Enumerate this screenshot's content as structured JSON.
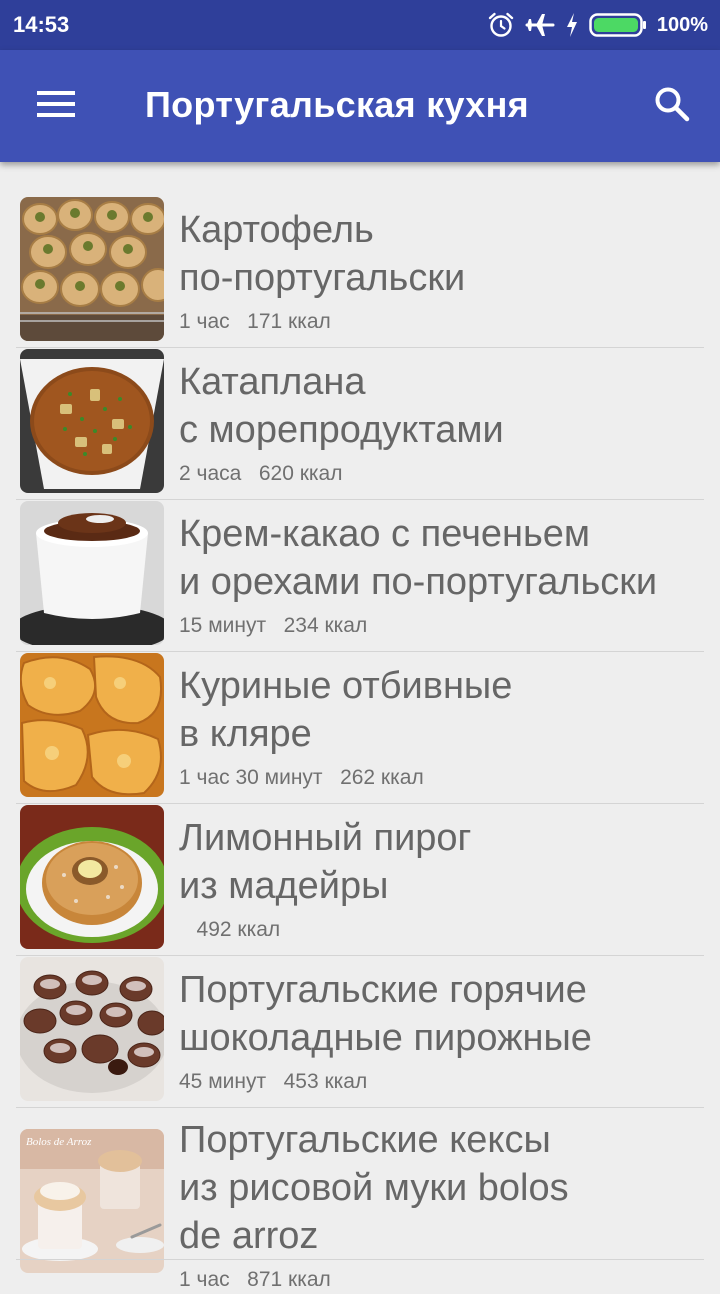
{
  "status_bar": {
    "time": "14:53",
    "battery": "100%",
    "icons": [
      "alarm-icon",
      "airplane-mode-icon",
      "charging-icon",
      "battery-icon"
    ]
  },
  "app_bar": {
    "title": "Португальская кухня",
    "menu_icon": "hamburger-menu-icon",
    "search_icon": "search-icon"
  },
  "recipes": [
    {
      "title": "Картофель\nпо-португальски",
      "time": "1 час",
      "kcal": "171 ккал",
      "image": "baked-potatoes"
    },
    {
      "title": "Катаплана\nс морепродуктами",
      "time": "2 часа",
      "kcal": "620 ккал",
      "image": "seafood-stew"
    },
    {
      "title": "Крем-какао с печеньем\nи орехами по-португальски",
      "time": "15 минут",
      "kcal": "234 ккал",
      "image": "cocoa-cream-cup"
    },
    {
      "title": "Куриные отбивные\nв кляре",
      "time": "1 час 30 минут",
      "kcal": "262 ккал",
      "image": "battered-chicken"
    },
    {
      "title": "Лимонный пирог\nиз мадейры",
      "time": "",
      "kcal": "492 ккал",
      "image": "lemon-bundt-cake"
    },
    {
      "title": "Португальские горячие\nшоколадные пирожные",
      "time": "45 минут",
      "kcal": "453 ккал",
      "image": "chocolate-cakes"
    },
    {
      "title": "Португальские кексы\nиз рисовой муки bolos\nde arroz",
      "time": "1 час",
      "kcal": "871 ккал",
      "image": "rice-cupcakes"
    }
  ],
  "thumbnail_caption_7": "Bolos de Arroz"
}
